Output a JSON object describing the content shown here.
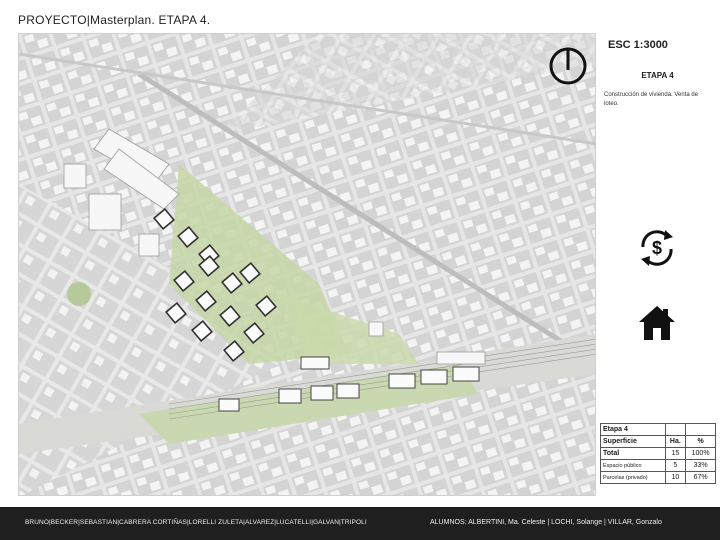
{
  "header": {
    "title": "PROYECTO|Masterplan. ETAPA 4."
  },
  "map": {
    "description_icon": "urban-masterplan-map"
  },
  "side_panel": {
    "scale": "ESC 1:3000",
    "north_icon": "north-arrow-icon",
    "stage_title": "ETAPA 4",
    "stage_description": "Construcción de vivienda. Venta de loteo.",
    "money_icon": "dollar-exchange-icon",
    "home_icon": "house-icon"
  },
  "table": {
    "title": "Etapa 4",
    "headers": [
      "Superficie",
      "Ha.",
      "%"
    ],
    "rows": [
      {
        "label": "Total",
        "ha": "15",
        "pct": "100%"
      },
      {
        "label": "Espacio público",
        "ha": "5",
        "pct": "33%"
      },
      {
        "label": "Parcelas (privado)",
        "ha": "10",
        "pct": "67%"
      }
    ]
  },
  "footer": {
    "groups": "BRUNO|BECKER|SEBASTIAN|CABRERA    CORTIÑAS|LORELLI    ZULETA|ALVAREZ|LUCATELLI|GALVAN|TRIPOLI",
    "students": "ALUMNOS: ALBERTINI, Ma. Celeste | LOCHI, Solange | VILLAR, Gonzalo"
  }
}
